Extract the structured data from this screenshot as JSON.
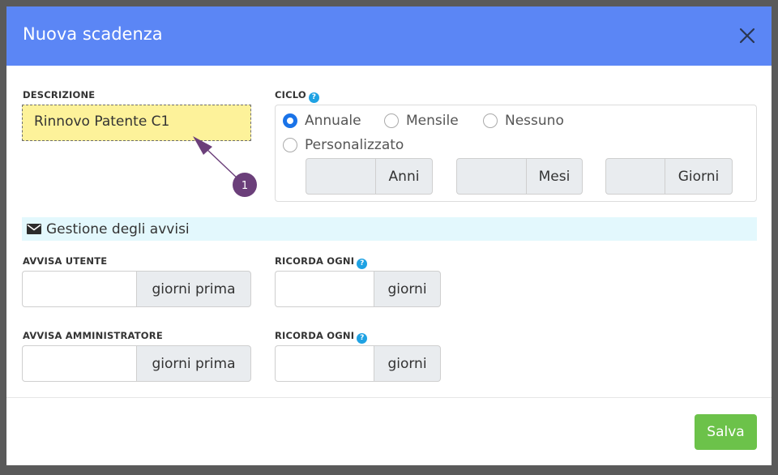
{
  "dialog": {
    "title": "Nuova scadenza",
    "close_icon": "close-icon"
  },
  "description": {
    "label": "DESCRIZIONE",
    "value": "Rinnovo Patente C1"
  },
  "cycle": {
    "label": "CICLO",
    "help_icon": "help-icon",
    "options": [
      {
        "label": "Annuale",
        "checked": true
      },
      {
        "label": "Mensile",
        "checked": false
      },
      {
        "label": "Nessuno",
        "checked": false
      },
      {
        "label": "Personalizzato",
        "checked": false
      }
    ],
    "custom": {
      "years_label": "Anni",
      "months_label": "Mesi",
      "days_label": "Giorni"
    }
  },
  "notifications": {
    "section_icon": "envelope-icon",
    "section_title": "Gestione degli avvisi",
    "notify_user_label": "AVVISA UTENTE",
    "notify_user_addon": "giorni prima",
    "remind_every_label": "RICORDA OGNI",
    "remind_every_addon": "giorni",
    "notify_admin_label": "AVVISA AMMINISTRATORE",
    "notify_admin_addon": "giorni prima",
    "remind_every_admin_label": "RICORDA OGNI",
    "remind_every_admin_addon": "giorni"
  },
  "annotation": {
    "marker_number": "1"
  },
  "footer": {
    "save_label": "Salva"
  },
  "colors": {
    "header": "#5b86f5",
    "highlight": "#fdf29a",
    "save": "#6cc24a",
    "marker": "#6b3f7a",
    "section_band": "#e3f8fd"
  }
}
